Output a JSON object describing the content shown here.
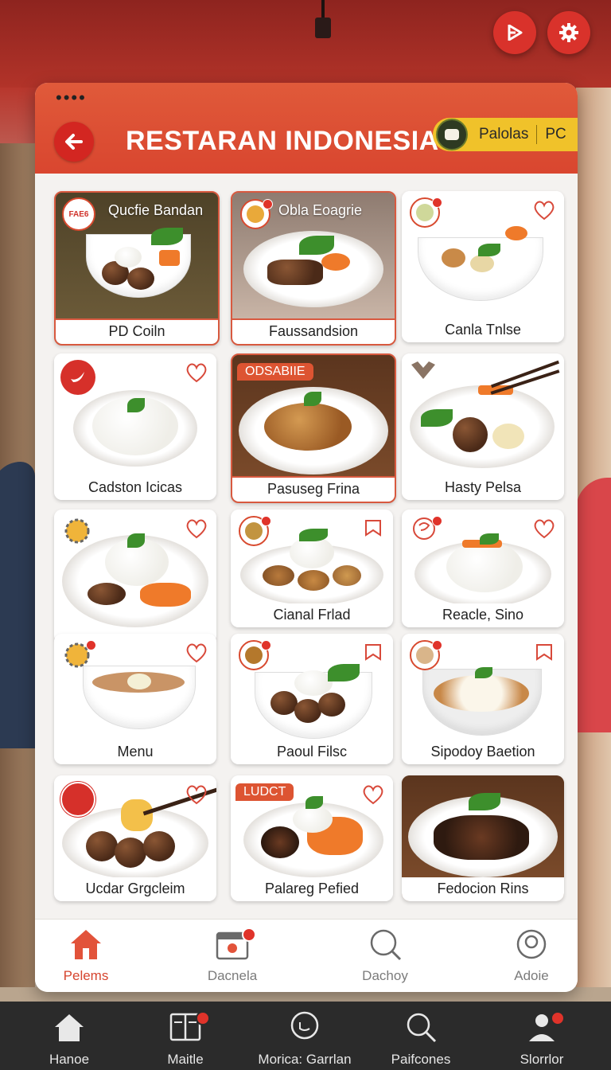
{
  "header": {
    "title": "RESTARAN INDONESIA",
    "pill_text": "Palolas",
    "pill_text2": "PC"
  },
  "cards": [
    {
      "label": "PD Coiln",
      "head": "Qucfie Bandan",
      "badge_text": "FAE6"
    },
    {
      "label": "Faussandsion",
      "head": "Obla Eoagrie"
    },
    {
      "label": "Canla Tnlse"
    },
    {
      "label": "Cadston Icicas"
    },
    {
      "label": "Pasuseg Frina",
      "ribbon": "ODSABIIE"
    },
    {
      "label": "Hasty Pelsa"
    },
    {
      "label": ""
    },
    {
      "label": "Cianal Frlad"
    },
    {
      "label": "Reacle, Sino"
    },
    {
      "label": "Menu"
    },
    {
      "label": "Paoul Filsc"
    },
    {
      "label": "Sipodoy Baetion"
    },
    {
      "label": "Ucdar Grgcleim"
    },
    {
      "label": "Palareg Pefied",
      "ribbon": "LUDCT"
    },
    {
      "label": "Fedocion Rins"
    }
  ],
  "inner_nav": [
    {
      "label": "Pelems",
      "icon": "home-icon",
      "active": true
    },
    {
      "label": "Dacnela",
      "icon": "calendar-icon"
    },
    {
      "label": "Dachoy",
      "icon": "search-icon"
    },
    {
      "label": "Adoie",
      "icon": "profile-icon"
    }
  ],
  "system_nav": [
    {
      "label": "Hanoe",
      "icon": "home-icon"
    },
    {
      "label": "Maitle",
      "icon": "menu-book-icon"
    },
    {
      "label": "Morica: Garrlan",
      "icon": "chat-icon"
    },
    {
      "label": "Paifcones",
      "icon": "search-icon"
    },
    {
      "label": "Slorrlor",
      "icon": "user-icon"
    }
  ],
  "colors": {
    "accent": "#d9462f",
    "pill": "#f0c22a",
    "nav_dark": "#2b2b2b"
  }
}
